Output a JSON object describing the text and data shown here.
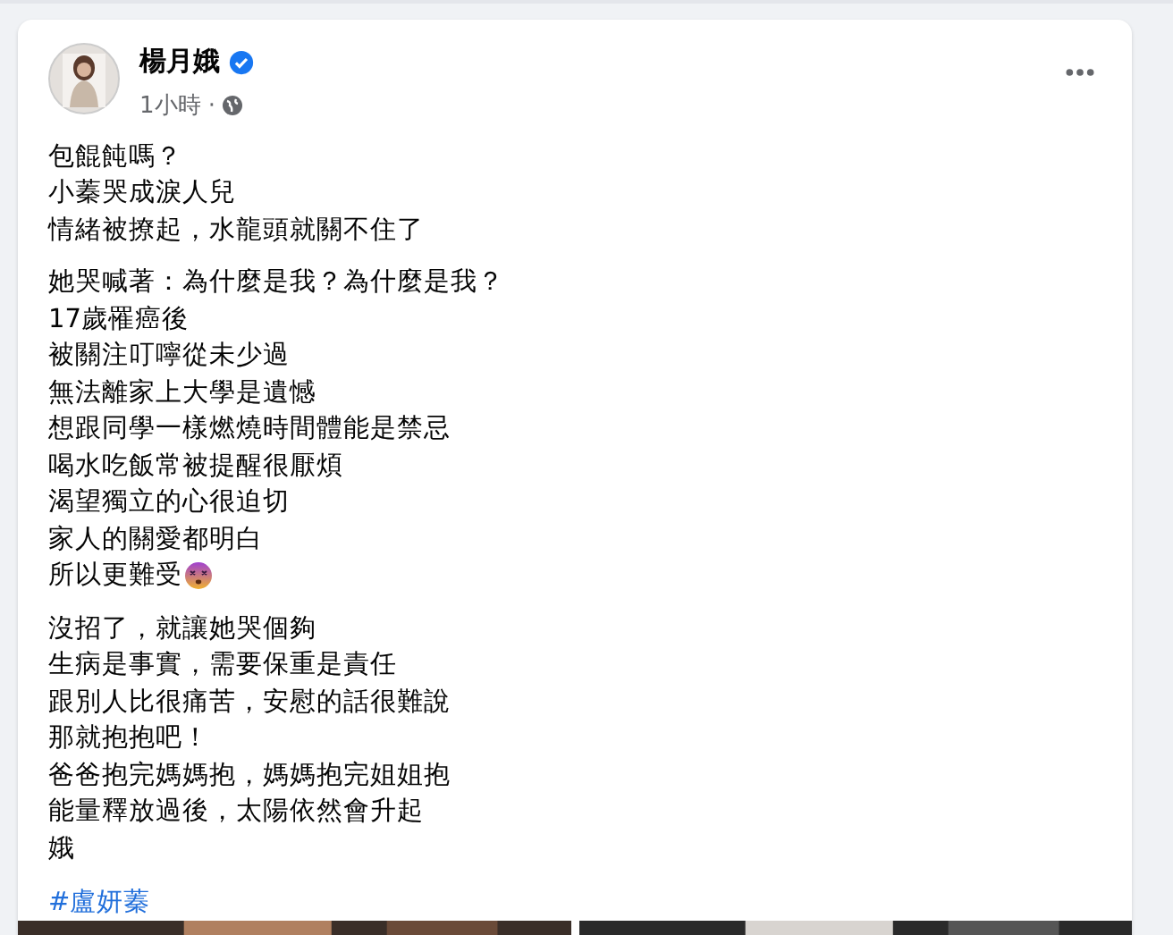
{
  "post": {
    "author": "楊月娥",
    "verified": true,
    "time": "1小時 ·",
    "paragraphs": [
      {
        "lines": [
          {
            "text": "包餛飩嗎？",
            "emoji": false
          },
          {
            "text": "小蓁哭成淚人兒",
            "emoji": false
          },
          {
            "text": "情緒被撩起，水龍頭就關不住了",
            "emoji": false
          }
        ]
      },
      {
        "lines": [
          {
            "text": "她哭喊著：為什麼是我？為什麼是我？",
            "emoji": false
          },
          {
            "text": "17歲罹癌後",
            "emoji": false
          },
          {
            "text": "被關注叮嚀從未少過",
            "emoji": false
          },
          {
            "text": "無法離家上大學是遺憾",
            "emoji": false
          },
          {
            "text": "想跟同學一樣燃燒時間體能是禁忌",
            "emoji": false
          },
          {
            "text": "喝水吃飯常被提醒很厭煩",
            "emoji": false
          },
          {
            "text": "渴望獨立的心很迫切",
            "emoji": false
          },
          {
            "text": "家人的關愛都明白",
            "emoji": false
          },
          {
            "text": "所以更難受",
            "emoji": true
          }
        ]
      },
      {
        "lines": [
          {
            "text": "沒招了，就讓她哭個夠",
            "emoji": false
          },
          {
            "text": "生病是事實，需要保重是責任",
            "emoji": false
          },
          {
            "text": "跟別人比很痛苦，安慰的話很難說",
            "emoji": false
          },
          {
            "text": "那就抱抱吧！",
            "emoji": false
          },
          {
            "text": "爸爸抱完媽媽抱，媽媽抱完姐姐抱",
            "emoji": false
          },
          {
            "text": "能量釋放過後，太陽依然會升起",
            "emoji": false
          },
          {
            "text": "娥",
            "emoji": false
          }
        ]
      }
    ],
    "hashtag": "#盧妍蓁"
  }
}
